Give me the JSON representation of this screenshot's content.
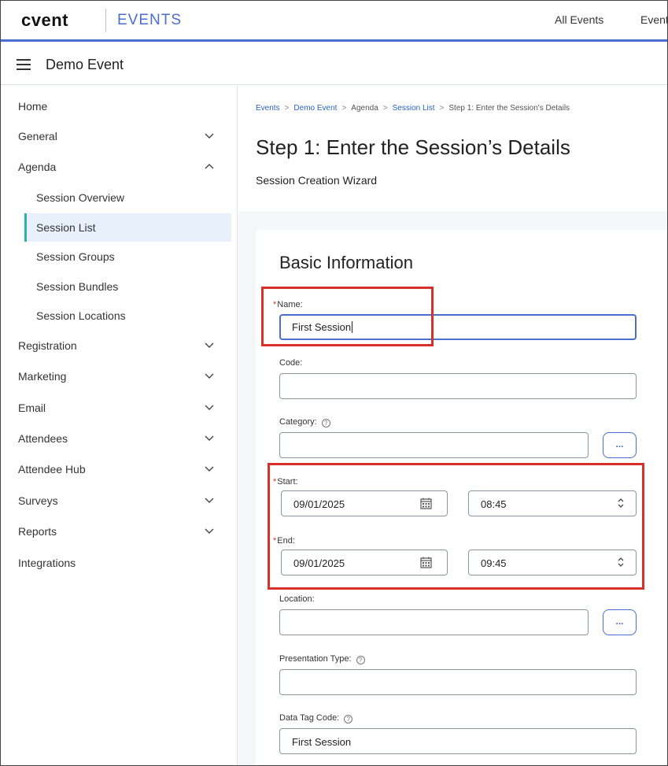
{
  "topbar": {
    "logo": "cvent",
    "product": "EVENTS",
    "nav": [
      "All Events",
      "Events"
    ]
  },
  "event": {
    "name": "Demo Event"
  },
  "sidebar": {
    "items": [
      {
        "label": "Home"
      },
      {
        "label": "General",
        "chevron": "down"
      },
      {
        "label": "Agenda",
        "chevron": "up"
      },
      {
        "label": "Registration",
        "chevron": "down"
      },
      {
        "label": "Marketing",
        "chevron": "down"
      },
      {
        "label": "Email",
        "chevron": "down"
      },
      {
        "label": "Attendees",
        "chevron": "down"
      },
      {
        "label": "Attendee Hub",
        "chevron": "down"
      },
      {
        "label": "Surveys",
        "chevron": "down"
      },
      {
        "label": "Reports",
        "chevron": "down"
      },
      {
        "label": "Integrations"
      }
    ],
    "agenda_sub": [
      {
        "label": "Session Overview"
      },
      {
        "label": "Session List",
        "active": true
      },
      {
        "label": "Session Groups"
      },
      {
        "label": "Session Bundles"
      },
      {
        "label": "Session Locations"
      }
    ]
  },
  "breadcrumb": [
    "Events",
    "Demo Event",
    "Agenda",
    "Session List",
    "Step 1: Enter the Session's Details"
  ],
  "page": {
    "title": "Step 1: Enter the Session’s Details",
    "subtitle": "Session Creation Wizard"
  },
  "form": {
    "section_title": "Basic Information",
    "name_label": "Name:",
    "name_value": "First Session",
    "code_label": "Code:",
    "code_value": "",
    "category_label": "Category:",
    "category_value": "",
    "start_label": "Start:",
    "start_date": "09/01/2025",
    "start_time": "08:45",
    "end_label": "End:",
    "end_date": "09/01/2025",
    "end_time": "09:45",
    "location_label": "Location:",
    "location_value": "",
    "presentation_type_label": "Presentation Type:",
    "presentation_type_value": "",
    "data_tag_label": "Data Tag Code:",
    "data_tag_value": "First Session",
    "more_button": "...",
    "required_mark": "*"
  },
  "colors": {
    "accent": "#4a6fd1",
    "active_marker": "#2bb3a6",
    "active_bg": "#e8f1fb",
    "highlight": "#d9302a",
    "required": "#c0392b"
  }
}
